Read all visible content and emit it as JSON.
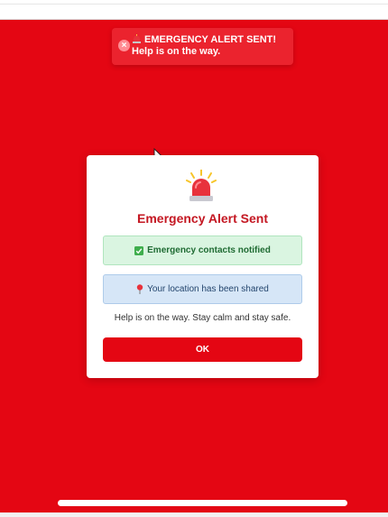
{
  "toast": {
    "title": "EMERGENCY ALERT SENT!",
    "message": "Help is on the way.",
    "close_icon": "close-icon",
    "siren_icon": "siren-icon"
  },
  "modal": {
    "icon": "siren-icon",
    "title": "Emergency Alert Sent",
    "contacts_status": "Emergency contacts notified",
    "contacts_icon": "check-icon",
    "location_status": "Your location has been shared",
    "location_icon": "pin-icon",
    "message": "Help is on the way. Stay calm and stay safe.",
    "ok_label": "OK"
  },
  "colors": {
    "background": "#e40613",
    "title": "#c41722",
    "success_bg": "#daf5e1",
    "info_bg": "#d6e6f7",
    "button": "#e40613"
  }
}
